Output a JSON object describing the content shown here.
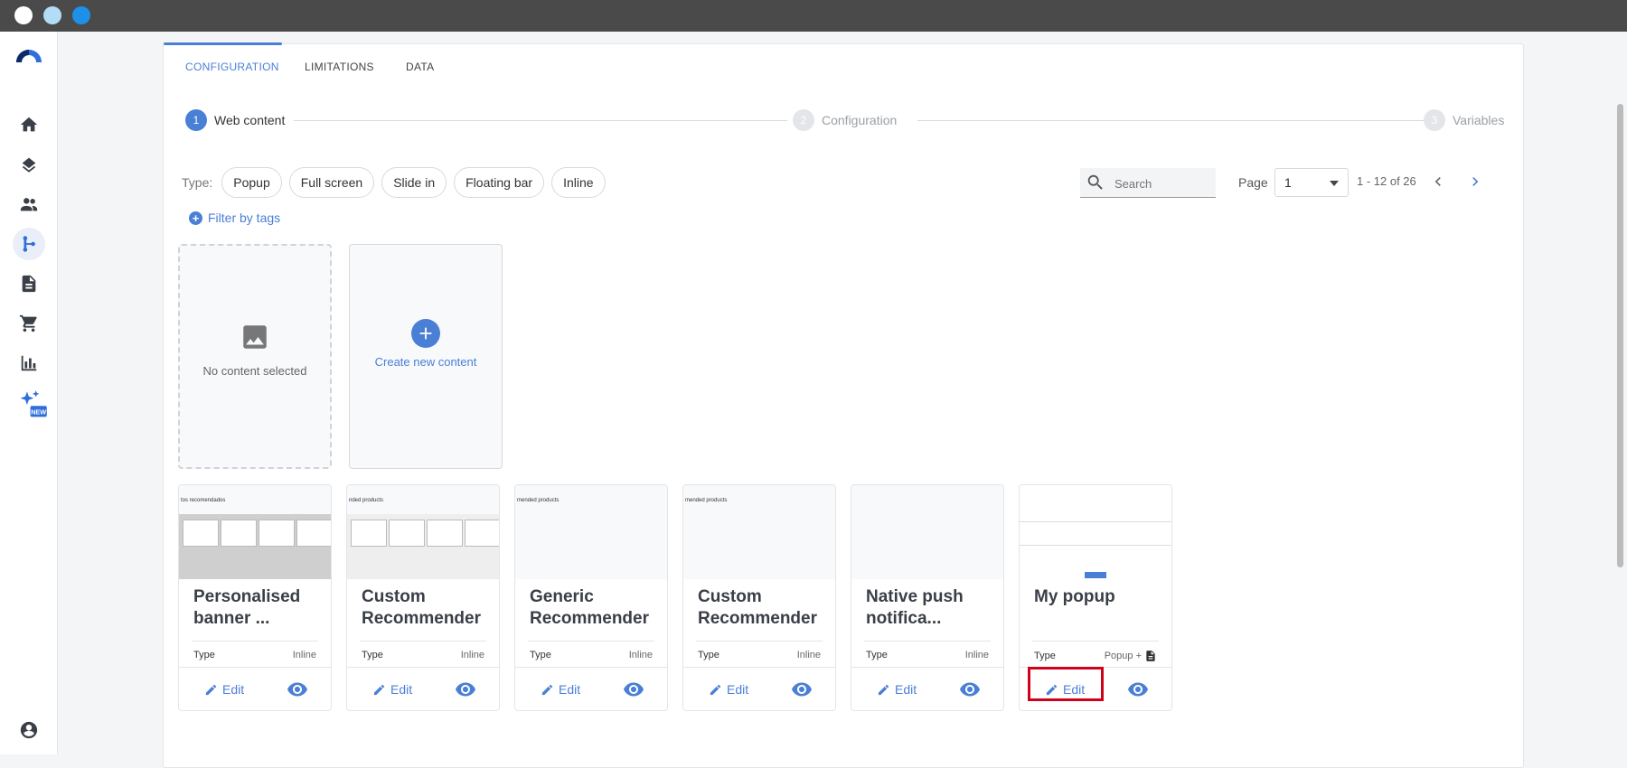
{
  "tabs": [
    {
      "label": "CONFIGURATION"
    },
    {
      "label": "LIMITATIONS"
    },
    {
      "label": "DATA"
    }
  ],
  "stepper": [
    {
      "num": "1",
      "label": "Web content"
    },
    {
      "num": "2",
      "label": "Configuration"
    },
    {
      "num": "3",
      "label": "Variables"
    }
  ],
  "filters": {
    "type_label": "Type:",
    "chips": [
      "Popup",
      "Full screen",
      "Slide in",
      "Floating bar",
      "Inline"
    ],
    "filter_tags": "Filter by tags"
  },
  "search": {
    "placeholder": "Search"
  },
  "pagination": {
    "page_label": "Page",
    "page": "1",
    "range": "1 - 12 of 26"
  },
  "empty_card": {
    "label": "No content selected"
  },
  "create_card": {
    "label": "Create new content"
  },
  "cards": [
    {
      "title": "Personalised banner ...",
      "type_key": "Type",
      "type_value": "Inline",
      "edit": "Edit",
      "thumb_text": "tos recomendados"
    },
    {
      "title": "Custom Recommender",
      "type_key": "Type",
      "type_value": "Inline",
      "edit": "Edit",
      "thumb_text": "nded products"
    },
    {
      "title": "Generic Recommender",
      "type_key": "Type",
      "type_value": "Inline",
      "edit": "Edit",
      "thumb_text": "mended products"
    },
    {
      "title": "Custom Recommender",
      "type_key": "Type",
      "type_value": "Inline",
      "edit": "Edit",
      "thumb_text": "mended products"
    },
    {
      "title": "Native push notifica...",
      "type_key": "Type",
      "type_value": "Inline",
      "edit": "Edit",
      "thumb_text": ""
    },
    {
      "title": "My popup",
      "type_key": "Type",
      "type_value": "Popup +",
      "edit": "Edit",
      "thumb_text": ""
    }
  ],
  "colors": {
    "accent": "#4a7fd6",
    "highlight": "#d0021b"
  }
}
